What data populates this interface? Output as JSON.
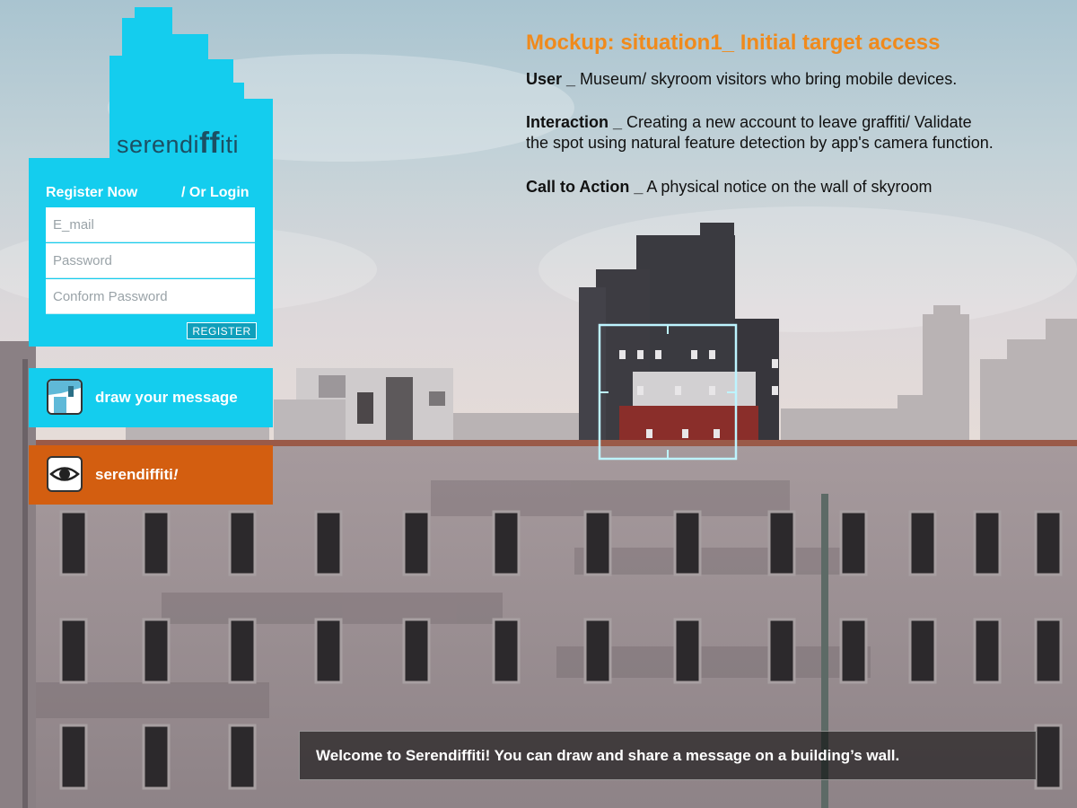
{
  "annotation": {
    "title": "Mockup: situation1_ Initial target access",
    "user_label": "User _",
    "user_text": " Museum/ skyroom visitors who bring mobile devices.",
    "interaction_label": "Interaction _",
    "interaction_text_1": " Creating a new account to leave graffiti/ Validate",
    "interaction_text_2": "the spot using natural feature detection by app's camera function.",
    "cta_label": "Call to Action _",
    "cta_text": " A physical notice on the wall of skyroom"
  },
  "logo": {
    "prefix": "serendi",
    "ff": "ff",
    "suffix": "iti"
  },
  "register": {
    "heading": "Register Now",
    "login_link": "/ Or Login",
    "email_placeholder": "E_mail",
    "password_placeholder": "Password",
    "confirm_placeholder": "Conform Password",
    "button": "REGISTER"
  },
  "menu": {
    "draw_label": "draw your message",
    "view_label": "serendiffiti",
    "view_suffix": "!"
  },
  "welcome": "Welcome to Serendiffiti! You can draw and share a message on a building’s wall.",
  "colors": {
    "accent_cyan": "#14cdee",
    "accent_orange": "#d35e10",
    "title_orange": "#f08a1c"
  },
  "icons": {
    "draw": "paint-roller-icon",
    "view": "eye-icon",
    "target": "detection-frame-icon"
  }
}
